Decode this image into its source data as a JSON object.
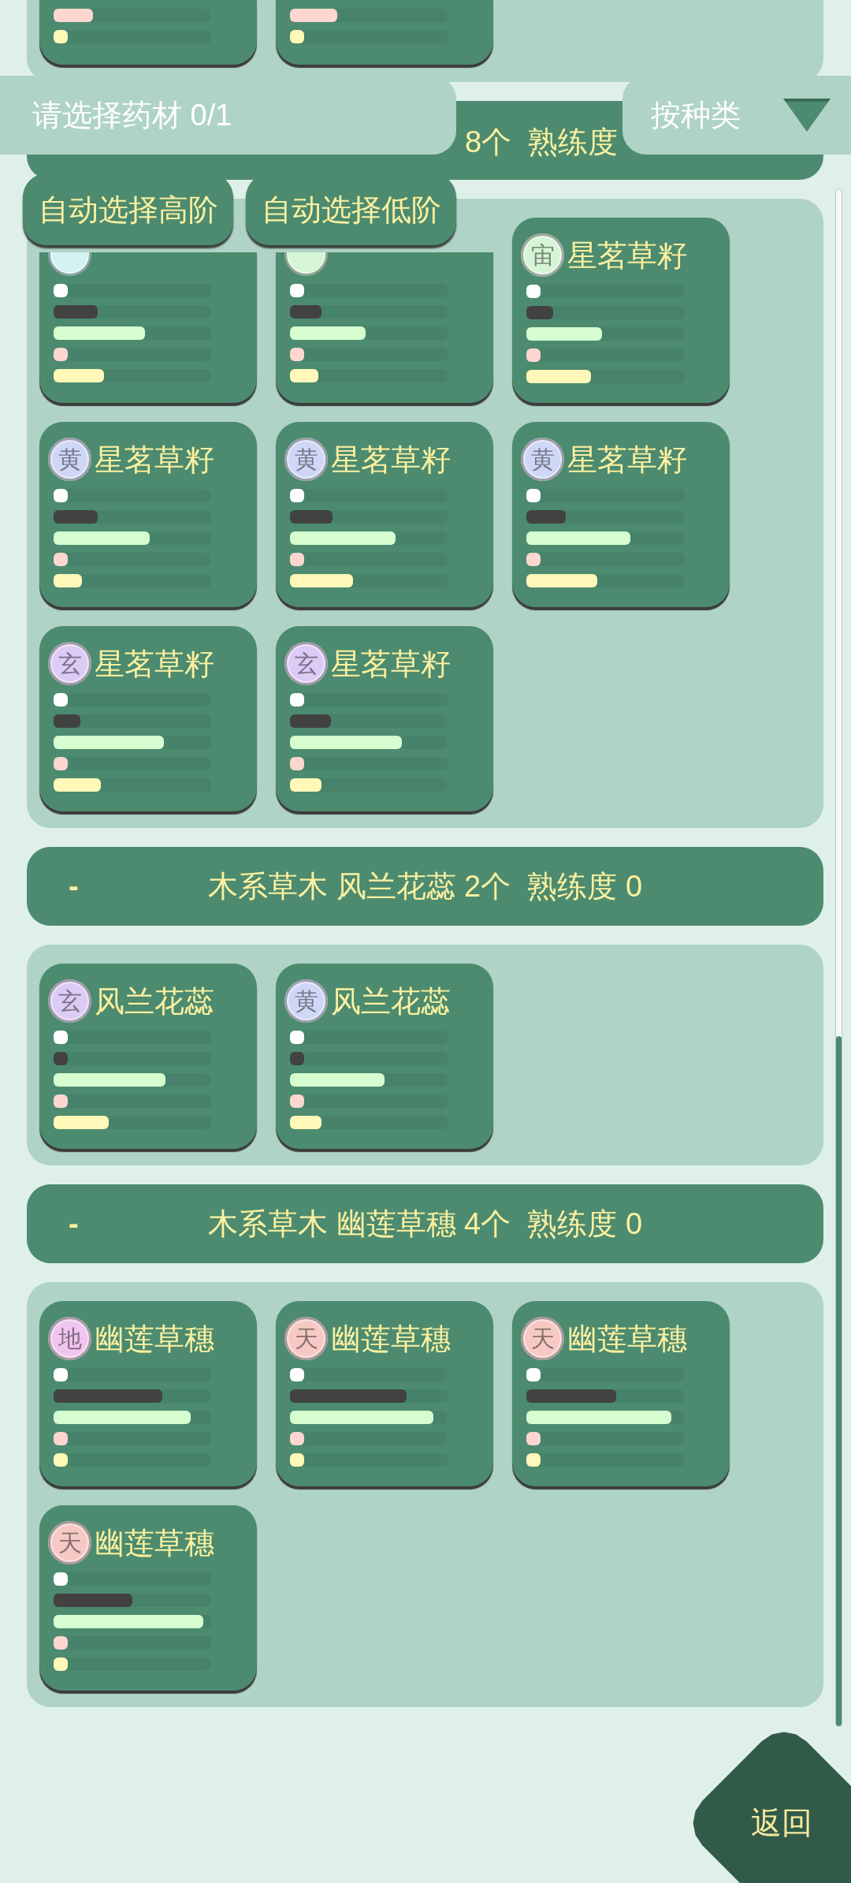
{
  "sections": [
    {
      "kind": "cut",
      "cards": [
        {
          "kind": "cut",
          "bars": [
            {
              "color": "#fdd6d0",
              "level": 0.25
            },
            {
              "color": "#fff8b8",
              "level": 0.09
            }
          ]
        },
        {
          "kind": "cut",
          "bars": [
            {
              "color": "#fdd6d0",
              "level": 0.3
            },
            {
              "color": "#fff8b8",
              "level": 0.09
            }
          ]
        }
      ]
    },
    {
      "kind": "full",
      "header": {
        "kind": "covered",
        "title": "8个  熟练度"
      },
      "cards": [
        {
          "kind": "covered",
          "badge": {
            "color": "#d2f2f2"
          },
          "bars": [
            {
              "color": "#ffffff",
              "level": 0.09
            },
            {
              "color": "#424242",
              "level": 0.28
            },
            {
              "color": "#d6fdd0",
              "level": 0.58
            },
            {
              "color": "#fdd6d0",
              "level": 0.09
            },
            {
              "color": "#fff8b8",
              "level": 0.32
            }
          ]
        },
        {
          "kind": "covered",
          "badge": {
            "color": "#d6f4d6"
          },
          "bars": [
            {
              "color": "#ffffff",
              "level": 0.09
            },
            {
              "color": "#424242",
              "level": 0.2
            },
            {
              "color": "#d6fdd0",
              "level": 0.48
            },
            {
              "color": "#fdd6d0",
              "level": 0.09
            },
            {
              "color": "#fff8b8",
              "level": 0.18
            }
          ]
        },
        {
          "kind": "full",
          "badge": {
            "grade": "宙",
            "color": "#d6f4d6"
          },
          "name": "星茗草籽",
          "bars": [
            {
              "color": "#ffffff",
              "level": 0.09
            },
            {
              "color": "#424242",
              "level": 0.17
            },
            {
              "color": "#d6fdd0",
              "level": 0.48
            },
            {
              "color": "#fdd6d0",
              "level": 0.09
            },
            {
              "color": "#fff8b8",
              "level": 0.41
            }
          ]
        },
        {
          "kind": "full",
          "badge": {
            "grade": "黄",
            "color": "#cfd7f6"
          },
          "name": "星茗草籽",
          "bars": [
            {
              "color": "#ffffff",
              "level": 0.09
            },
            {
              "color": "#424242",
              "level": 0.28
            },
            {
              "color": "#d6fdd0",
              "level": 0.61
            },
            {
              "color": "#fdd6d0",
              "level": 0.09
            },
            {
              "color": "#fff8b8",
              "level": 0.18
            }
          ]
        },
        {
          "kind": "full",
          "badge": {
            "grade": "黄",
            "color": "#cfd7f6"
          },
          "name": "星茗草籽",
          "bars": [
            {
              "color": "#ffffff",
              "level": 0.09
            },
            {
              "color": "#424242",
              "level": 0.27
            },
            {
              "color": "#d6fdd0",
              "level": 0.67
            },
            {
              "color": "#fdd6d0",
              "level": 0.09
            },
            {
              "color": "#fff8b8",
              "level": 0.4
            }
          ]
        },
        {
          "kind": "full",
          "badge": {
            "grade": "黄",
            "color": "#cfd7f6"
          },
          "name": "星茗草籽",
          "bars": [
            {
              "color": "#ffffff",
              "level": 0.09
            },
            {
              "color": "#424242",
              "level": 0.25
            },
            {
              "color": "#d6fdd0",
              "level": 0.66
            },
            {
              "color": "#fdd6d0",
              "level": 0.09
            },
            {
              "color": "#fff8b8",
              "level": 0.45
            }
          ]
        },
        {
          "kind": "full",
          "badge": {
            "grade": "玄",
            "color": "#dccbf5"
          },
          "name": "星茗草籽",
          "bars": [
            {
              "color": "#ffffff",
              "level": 0.09
            },
            {
              "color": "#424242",
              "level": 0.17
            },
            {
              "color": "#d6fdd0",
              "level": 0.7
            },
            {
              "color": "#fdd6d0",
              "level": 0.09
            },
            {
              "color": "#fff8b8",
              "level": 0.3
            }
          ]
        },
        {
          "kind": "full",
          "badge": {
            "grade": "玄",
            "color": "#dccbf5"
          },
          "name": "星茗草籽",
          "bars": [
            {
              "color": "#ffffff",
              "level": 0.09
            },
            {
              "color": "#424242",
              "level": 0.26
            },
            {
              "color": "#d6fdd0",
              "level": 0.71
            },
            {
              "color": "#fdd6d0",
              "level": 0.09
            },
            {
              "color": "#fff8b8",
              "level": 0.2
            }
          ]
        }
      ]
    },
    {
      "kind": "full",
      "header": {
        "kind": "full",
        "toggle": "-",
        "title": "木系草木 风兰花蕊 2个  熟练度 0"
      },
      "cards": [
        {
          "kind": "full",
          "badge": {
            "grade": "玄",
            "color": "#dccbf5"
          },
          "name": "风兰花蕊",
          "bars": [
            {
              "color": "#ffffff",
              "level": 0.09
            },
            {
              "color": "#424242",
              "level": 0.09
            },
            {
              "color": "#d6fdd0",
              "level": 0.71
            },
            {
              "color": "#fdd6d0",
              "level": 0.09
            },
            {
              "color": "#fff8b8",
              "level": 0.35
            }
          ]
        },
        {
          "kind": "full",
          "badge": {
            "grade": "黄",
            "color": "#cfd7f6"
          },
          "name": "风兰花蕊",
          "bars": [
            {
              "color": "#ffffff",
              "level": 0.09
            },
            {
              "color": "#424242",
              "level": 0.09
            },
            {
              "color": "#d6fdd0",
              "level": 0.6
            },
            {
              "color": "#fdd6d0",
              "level": 0.09
            },
            {
              "color": "#fff8b8",
              "level": 0.2
            }
          ]
        }
      ]
    },
    {
      "kind": "full",
      "header": {
        "kind": "full",
        "toggle": "-",
        "title": "木系草木 幽莲草穗 4个  熟练度 0"
      },
      "cards": [
        {
          "kind": "full",
          "badge": {
            "grade": "地",
            "color": "#f0c5ef"
          },
          "name": "幽莲草穗",
          "bars": [
            {
              "color": "#ffffff",
              "level": 0.09
            },
            {
              "color": "#424242",
              "level": 0.69
            },
            {
              "color": "#d6fdd0",
              "level": 0.87
            },
            {
              "color": "#fdd6d0",
              "level": 0.09
            },
            {
              "color": "#fff8b8",
              "level": 0.09
            }
          ]
        },
        {
          "kind": "full",
          "badge": {
            "grade": "天",
            "color": "#f6c9c5"
          },
          "name": "幽莲草穗",
          "bars": [
            {
              "color": "#ffffff",
              "level": 0.09
            },
            {
              "color": "#424242",
              "level": 0.74
            },
            {
              "color": "#d6fdd0",
              "level": 0.91
            },
            {
              "color": "#fdd6d0",
              "level": 0.09
            },
            {
              "color": "#fff8b8",
              "level": 0.09
            }
          ]
        },
        {
          "kind": "full",
          "badge": {
            "grade": "天",
            "color": "#f6c9c5"
          },
          "name": "幽莲草穗",
          "bars": [
            {
              "color": "#ffffff",
              "level": 0.09
            },
            {
              "color": "#424242",
              "level": 0.57
            },
            {
              "color": "#d6fdd0",
              "level": 0.92
            },
            {
              "color": "#fdd6d0",
              "level": 0.09
            },
            {
              "color": "#fff8b8",
              "level": 0.09
            }
          ]
        },
        {
          "kind": "full",
          "badge": {
            "grade": "天",
            "color": "#f6c9c5"
          },
          "name": "幽莲草穗",
          "bars": [
            {
              "color": "#ffffff",
              "level": 0.09
            },
            {
              "color": "#424242",
              "level": 0.5
            },
            {
              "color": "#d6fdd0",
              "level": 0.95
            },
            {
              "color": "#fdd6d0",
              "level": 0.09
            },
            {
              "color": "#fff8b8",
              "level": 0.09
            }
          ]
        }
      ]
    }
  ],
  "selection_status": "请选择药材 0/1",
  "sort_dropdown": {
    "label": "按种类"
  },
  "auto_buttons": [
    "自动选择高阶",
    "自动选择低阶"
  ],
  "back_button": "返回"
}
